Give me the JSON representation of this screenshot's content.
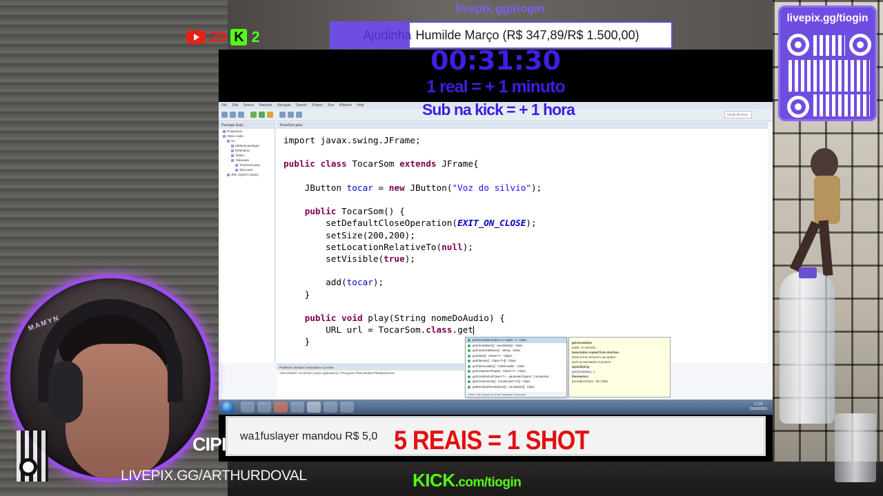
{
  "overlay": {
    "livepix_top": "livepix.gg/tiogin",
    "youtube_count": "29",
    "kick_count": "2",
    "kick_icon_letter": "K",
    "goal": {
      "label": "Ajudinha",
      "text": "Humilde Março (R$ 347,89/R$ 1.500,00)",
      "progress_fraction": 0.232
    },
    "timer": "00:31:30",
    "rule_1": "1 real = + 1 minuto",
    "rule_2": "Sub na kick = + 1 hora",
    "alert_text": "wa1fuslayer mandou R$ 5,0",
    "shot_text": "5 REAIS = 1 SHOT",
    "qr_title": "livepix.gg/tiogin",
    "artlink": "LIVEPIX.GG/ARTHURDOVAL",
    "cipi": "CIPI",
    "webcam_label": "MAMYN",
    "kick_footer_main": "KICK",
    "kick_footer_suffix": ".com/tiogin",
    "colors": {
      "brand_purple": "#6f4de0",
      "timer_blue": "#3c1fe0",
      "kick_green": "#53fc18",
      "youtube_red": "#e62117",
      "shot_red": "#e31010"
    }
  },
  "eclipse": {
    "menu": [
      "File",
      "Edit",
      "Source",
      "Refactor",
      "Navigate",
      "Search",
      "Project",
      "Run",
      "Window",
      "Help"
    ],
    "quick_access": "Quick Access",
    "package_explorer_tab": "Package Expl...",
    "package_tree": [
      "Programas",
      "Video Audio",
      "src",
      "(default package)",
      "Relembrar",
      "Testes",
      "Videoaula",
      "TocarSom.java",
      "silvio.wav",
      "JRE System Library"
    ],
    "editor_tab": "TocarSom.java",
    "code": {
      "l0": "import javax.swing.JFrame;",
      "l1_kw1": "public",
      "l1_kw2": "class",
      "l1_name": " TocarSom ",
      "l1_kw3": "extends",
      "l1_rest": " JFrame{",
      "l2_a": "JButton ",
      "l2_field": "tocar",
      "l2_b": " = ",
      "l2_kw": "new",
      "l2_c": " JButton(",
      "l2_str": "\"Voz do silvio\"",
      "l2_d": ");",
      "l3_kw": "public",
      "l3_rest": " TocarSom() {",
      "l4_a": "setDefaultCloseOperation(",
      "l4_const": "EXIT_ON_CLOSE",
      "l4_b": ");",
      "l5": "setSize(200,200);",
      "l6_a": "setLocationRelativeTo(",
      "l6_kw": "null",
      "l6_b": ");",
      "l7_a": "setVisible(",
      "l7_kw": "true",
      "l7_b": ");",
      "l8_a": "add(",
      "l8_field": "tocar",
      "l8_b": ");",
      "l9": "}",
      "l10_kw1": "public",
      "l10_kw2": "void",
      "l10_a": " play(String ",
      "l10_param": "nomeDoAudio",
      "l10_b": ") {",
      "l11_a": "URL url = TocarSom.",
      "l11_kw": "class",
      "l11_b": ".get",
      "l12": "}"
    },
    "console_tabs": "Problems  Javadoc  Declaration  Console",
    "console_line": "<terminated> TocarSom [Java Application] C:\\Program Files\\Java\\jre7\\bin\\javaw.exe",
    "autocomplete": [
      "getAnnotation(Class<A> arg0) : A - Class",
      "getAnnotations() : Annotation[] - Class",
      "getCanonicalName() : String - Class",
      "getClass() : Class<?> - Object",
      "getClasses() : Class<?>[] - Class",
      "getClassLoader() : ClassLoader - Class",
      "getComponentType() : Class<?> - Class",
      "getConstructor(Class<?>... parameterTypes) : Constructor",
      "getConstructors() : Constructor<?>[] - Class",
      "getDeclaredAnnotations() : Annotation[] - Class"
    ],
    "autocomplete_footer": "Press 'Ctrl+Space' to show Template Proposals",
    "javadoc": [
      "getAnnotation",
      "public <A extends ...",
      "Description copied from interface",
      "Returns this element's annotation",
      "such an annotation is present",
      "Specified by:",
      "getAnnotation(...)",
      "Parameters:",
      "annotationClass - the Class"
    ],
    "clock_time": "17:22",
    "clock_date": "25/03/2015"
  }
}
